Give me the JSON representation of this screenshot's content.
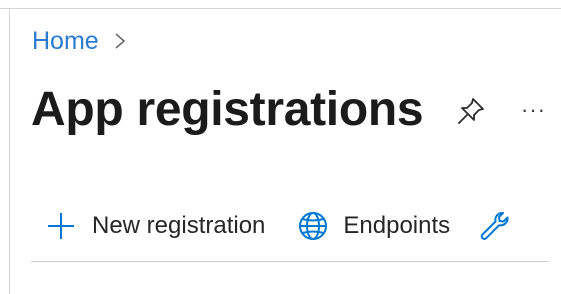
{
  "breadcrumb": {
    "home_label": "Home"
  },
  "page": {
    "title": "App registrations",
    "more_label": "···"
  },
  "toolbar": {
    "new_registration_label": "New registration",
    "endpoints_label": "Endpoints"
  },
  "icons": {
    "pin": "pin-icon",
    "more": "more-icon",
    "add": "plus-icon",
    "endpoints": "globe-icon",
    "troubleshoot": "wrench-icon"
  },
  "colors": {
    "link": "#2b7bd1",
    "accent_icon": "#0078d4",
    "text": "#1b1b1b"
  }
}
